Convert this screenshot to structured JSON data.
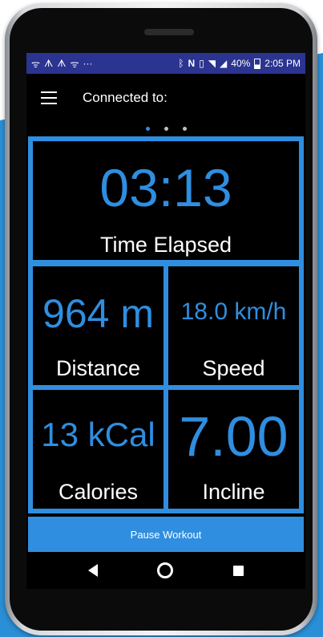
{
  "status_bar": {
    "left_icons": [
      "signal-icon",
      "flame-icon",
      "flame-icon",
      "signal-icon",
      "more-icon"
    ],
    "battery": "40%",
    "time": "2:05 PM"
  },
  "app_bar": {
    "title": "Connected to:"
  },
  "pager": {
    "pages": 3,
    "active": 0
  },
  "tiles": {
    "time": {
      "value": "03:13",
      "label": "Time Elapsed"
    },
    "distance": {
      "value": "964 m",
      "label": "Distance"
    },
    "speed": {
      "value": "18.0 km/h",
      "label": "Speed"
    },
    "calories": {
      "value": "13 kCal",
      "label": "Calories"
    },
    "incline": {
      "value": "7.00",
      "label": "Incline"
    }
  },
  "pause_button": "Pause Workout",
  "colors": {
    "accent": "#2f8ee0",
    "status_bar": "#2b3490",
    "background": "#000000"
  }
}
